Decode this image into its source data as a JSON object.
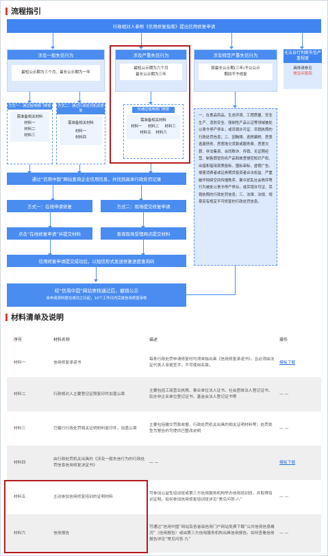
{
  "section1_title": "流程指引",
  "top_bar": "行政相对人参照《信用修复指南》提出信用修复申请",
  "col1": {
    "head": "涉及一般失信行为",
    "text": "最短公示期为三个月，最长公示期为一年"
  },
  "col2": {
    "head": "涉及严重失信行为",
    "text1": "最短公示期为六个月",
    "text2": "最长公示期为三年"
  },
  "col3": {
    "head": "涉及特定严重失信行为",
    "text1": "按最长公示期(三年)予以公示",
    "text2": "期间不予修复"
  },
  "side": {
    "head": "无法自行判断失信严重程度",
    "line1": "具体请参见",
    "line2": "常见问答四"
  },
  "way1": {
    "head": "方式一：通过信用部门修复",
    "need": "需准备相关材料",
    "items": [
      "材料一",
      "材料二",
      "材料三"
    ]
  },
  "way2": {
    "head": "方式二：通过行政处罚机关修复",
    "need": "需准备相关材料",
    "items": [
      "材料一",
      "材料四"
    ]
  },
  "way3": {
    "head": "仅通过信用部门修复",
    "need": "需准备相关材料",
    "items": [
      "材料一",
      "材料二",
      "材料三",
      "材料五",
      "材料六"
    ]
  },
  "long_text": "一、在食品药品、生态环境、工程质量、安全生产、消防安全、强制性产品认证等领域被处以责令停产停业，或吊销许可证、吊销执照的行政处罚信息；二、因贿赂、逃税骗税、恶意逃废债务、恶意拖欠货款或服务费、恶意欠薪、非法集资、合同欺诈、传销、无证照经营、制售假冒伪劣产品和故意侵犯知识产权、出借和借用资质投标、围标串标、虚假广告、侵害消费者或证券期货投资者合法权益、严重破坏网络空间传播秩序、聚众扰乱社会秩序等行为被处以责令停产停业，或吊销许可证、吊销执照的行政处罚信息；三、法律、法规、规章另有规定不可修复的行政处罚信息。",
  "query_bar": "通过“信用中国”网站查询企业信用信息，并找到具体行政处罚记录",
  "online": "方式一：在线申请修复",
  "onsite": "方式二：现场提交修复申请",
  "online_step": "点击“在线修复申请”并提交材料",
  "onsite_step": "查询现场受理网点提交材料",
  "sms_bar": "信用修复申请提交成功后，以短信形式发送修复进度查询码",
  "final_bar1": "经“信用中国”网站审核通过后，撤销公示",
  "final_bar2": "自申请资料提交成功之日起，10个工作日内完成信用修复审核",
  "section2_title": "材料清单及说明",
  "table": {
    "headers": [
      "序号",
      "材料名称",
      "描述",
      "操作"
    ],
    "rows": [
      {
        "no": "材料一",
        "name": "信用修复承诺书",
        "desc": "每条行政处罚申请修复时均须单独出具《信用修复承诺书》，且必须由法定代表人亲笔签字，不可使用名章。",
        "op": "模板下载"
      },
      {
        "no": "材料二",
        "name": "行政相对人主要登记证照复印件加盖公章",
        "desc": "主要包括工商营业执照、事业单位法人证书、社会团体法人登记证书、民办非企业单位登记证书、基金会法人登记证书等",
        "op": "— —"
      },
      {
        "no": "材料三",
        "name": "已履行行政处罚相关证明材料复印件，加盖公章",
        "desc": "主要包括缴交罚款收据，行政处罚机关出具的相关证明材料等；处罚类型为警告的可提供已整改说明",
        "op": "— —"
      },
      {
        "no": "材料四",
        "name": "由行政处罚机关出具的《涉及一般失信行为的行政处罚信息信用修复决定书》",
        "desc": "— —",
        "op": "模板下载"
      },
      {
        "no": "材料五",
        "name": "主动参加信用修复培训的证明材料",
        "desc": "可参加公益性培训班或第三方信用服务机构举办信用培训班，并取得培训证明。如何参加信用修复培训班详见“常见问答-八”",
        "op": "— —"
      },
      {
        "no": "材料六",
        "name": "信用报告",
        "desc": "可通过“信用中国”网站及各省级信用门户网站免费下载“公共信用信息概况”（信用报告）或由第三方信用服务机构出具信用报告。如何查看信用报告详见“常见问答-九”",
        "op": "— —"
      }
    ]
  }
}
